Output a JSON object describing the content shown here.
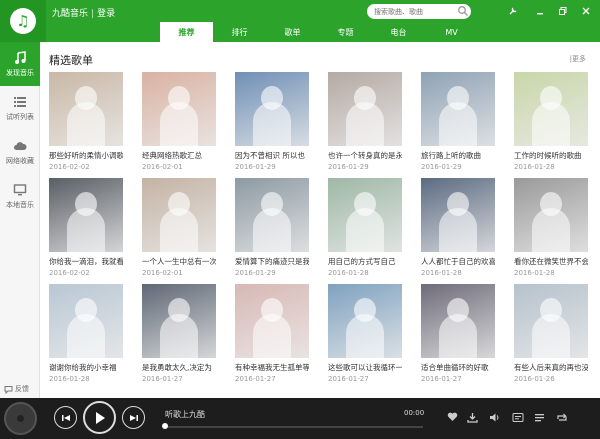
{
  "header": {
    "brand": "九酷音乐",
    "login": "登录",
    "search_placeholder": "搜索歌曲、歌曲"
  },
  "nav": {
    "tabs": [
      "推荐",
      "排行",
      "歌单",
      "专题",
      "电台",
      "MV"
    ],
    "active": 0
  },
  "sidebar": {
    "items": [
      {
        "label": "发现音乐",
        "icon": "music-note-icon"
      },
      {
        "label": "试听列表",
        "icon": "list-icon"
      },
      {
        "label": "网络收藏",
        "icon": "cloud-icon"
      },
      {
        "label": "本地音乐",
        "icon": "monitor-icon"
      }
    ],
    "feedback": "反馈"
  },
  "main": {
    "section_title": "精选歌单",
    "more": "更多",
    "playlists": [
      {
        "title": "那些好听的柔情小调歌",
        "date": "2016-02-02",
        "color": "#c9b8a6"
      },
      {
        "title": "经典网络热歌汇总",
        "date": "2016-02-01",
        "color": "#d9b2a2"
      },
      {
        "title": "因为不曾相识 所以也",
        "date": "2016-01-29",
        "color": "#6f8fb5"
      },
      {
        "title": "也许一个转身真的是永",
        "date": "2016-01-29",
        "color": "#b5aaa4"
      },
      {
        "title": "旅行路上听的歌曲",
        "date": "2016-01-29",
        "color": "#8fa2b5"
      },
      {
        "title": "工作的时候听的歌曲",
        "date": "2016-01-28",
        "color": "#c8d6a8"
      },
      {
        "title": "你给我一滴泪，我就看",
        "date": "2016-02-02",
        "color": "#5a5f66"
      },
      {
        "title": "一个人一生中总有一次",
        "date": "2016-02-01",
        "color": "#c4b3a4"
      },
      {
        "title": "爱情算下的痛迹只是我",
        "date": "2016-01-29",
        "color": "#8d9aa3"
      },
      {
        "title": "用自己的方式写自己",
        "date": "2016-01-28",
        "color": "#9fb8a6"
      },
      {
        "title": "人人都忙于自己的欢喜",
        "date": "2016-01-28",
        "color": "#5c6b82"
      },
      {
        "title": "看你还在微笑世界不会",
        "date": "2016-01-28",
        "color": "#9a9a9a"
      },
      {
        "title": "谢谢你给我的小幸福",
        "date": "2016-01-28",
        "color": "#b9c7d4"
      },
      {
        "title": "是我勇敢太久,决定为",
        "date": "2016-01-27",
        "color": "#5f6875"
      },
      {
        "title": "有种幸福我无生孤单等",
        "date": "2016-01-27",
        "color": "#d7b8b4"
      },
      {
        "title": "这些歌可以让我循环一",
        "date": "2016-01-27",
        "color": "#7fa2bf"
      },
      {
        "title": "适合单曲循环的好歌",
        "date": "2016-01-27",
        "color": "#6f6c7a"
      },
      {
        "title": "有些人后来真的再也没",
        "date": "2016-01-26",
        "color": "#b6c2cc"
      }
    ]
  },
  "player": {
    "track": "听歌上九酷",
    "time": "00:00",
    "progress": 0
  },
  "colors": {
    "accent": "#2ca42c",
    "player_bg": "#1d1d1d"
  }
}
